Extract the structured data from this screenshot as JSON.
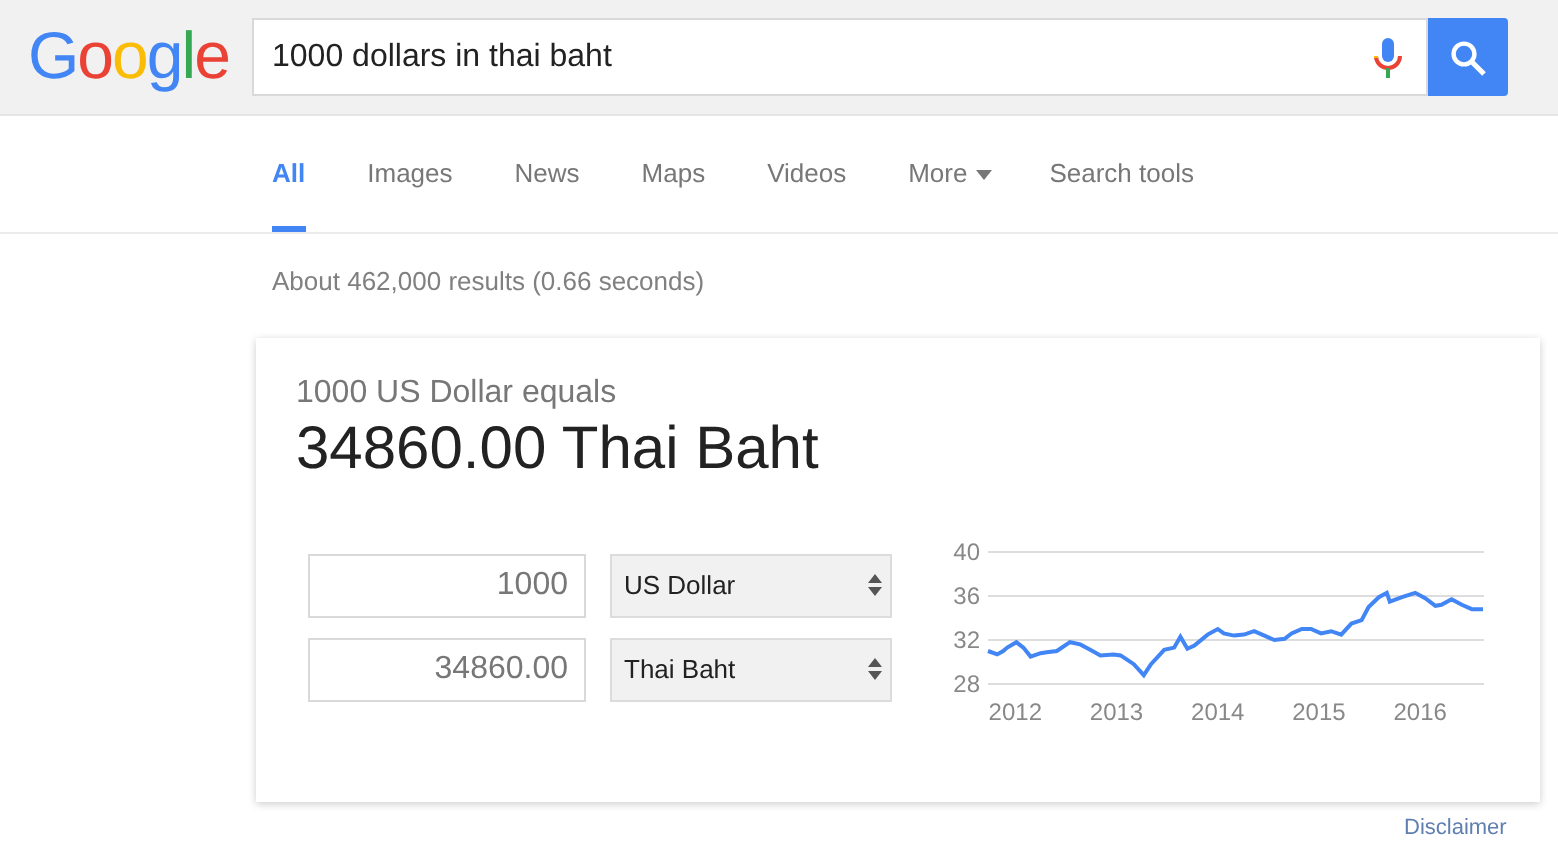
{
  "logo": "Google",
  "search": {
    "value": "1000 dollars in thai baht"
  },
  "tabs": [
    {
      "label": "All",
      "selected": true,
      "kind": "tab"
    },
    {
      "label": "Images",
      "selected": false,
      "kind": "tab"
    },
    {
      "label": "News",
      "selected": false,
      "kind": "tab"
    },
    {
      "label": "Maps",
      "selected": false,
      "kind": "tab"
    },
    {
      "label": "Videos",
      "selected": false,
      "kind": "tab"
    },
    {
      "label": "More",
      "selected": false,
      "kind": "menu"
    },
    {
      "label": "Search tools",
      "selected": false,
      "kind": "tools"
    }
  ],
  "result_stats": "About 462,000 results (0.66 seconds)",
  "converter": {
    "subtitle": "1000 US Dollar equals",
    "result": "34860.00 Thai Baht",
    "rows": [
      {
        "amount": "1000",
        "currency": "US Dollar"
      },
      {
        "amount": "34860.00",
        "currency": "Thai Baht"
      }
    ],
    "chart_data": {
      "type": "line",
      "xlim": [
        2011.75,
        2016.65
      ],
      "ylim": [
        28,
        40
      ],
      "xticks": [
        2012,
        2013,
        2014,
        2015,
        2016
      ],
      "yticks": [
        28,
        32,
        36,
        40
      ],
      "x": [
        2011.75,
        2011.84,
        2011.9,
        2011.94,
        2012.03,
        2012.1,
        2012.17,
        2012.27,
        2012.33,
        2012.43,
        2012.56,
        2012.66,
        2012.76,
        2012.86,
        2012.99,
        2013.06,
        2013.19,
        2013.29,
        2013.36,
        2013.49,
        2013.59,
        2013.65,
        2013.72,
        2013.79,
        2013.92,
        2014.02,
        2014.08,
        2014.18,
        2014.28,
        2014.38,
        2014.48,
        2014.58,
        2014.68,
        2014.75,
        2014.85,
        2014.94,
        2015.04,
        2015.14,
        2015.24,
        2015.34,
        2015.44,
        2015.51,
        2015.61,
        2015.69,
        2015.72,
        2015.84,
        2015.97,
        2016.07,
        2016.17,
        2016.23,
        2016.33,
        2016.43,
        2016.53,
        2016.64
      ],
      "series": [
        {
          "color": "#4285f4",
          "values": [
            31.0,
            30.7,
            31.0,
            31.3,
            31.8,
            31.3,
            30.5,
            30.8,
            30.9,
            31.0,
            31.8,
            31.6,
            31.1,
            30.6,
            30.7,
            30.6,
            29.8,
            28.8,
            29.8,
            31.1,
            31.3,
            32.3,
            31.2,
            31.5,
            32.5,
            33.0,
            32.6,
            32.4,
            32.5,
            32.8,
            32.4,
            32.0,
            32.1,
            32.6,
            33.0,
            33.0,
            32.6,
            32.8,
            32.5,
            33.5,
            33.8,
            35.0,
            35.9,
            36.3,
            35.5,
            35.9,
            36.3,
            35.8,
            35.1,
            35.2,
            35.7,
            35.2,
            34.8,
            34.8
          ]
        }
      ]
    }
  },
  "disclaimer": "Disclaimer"
}
